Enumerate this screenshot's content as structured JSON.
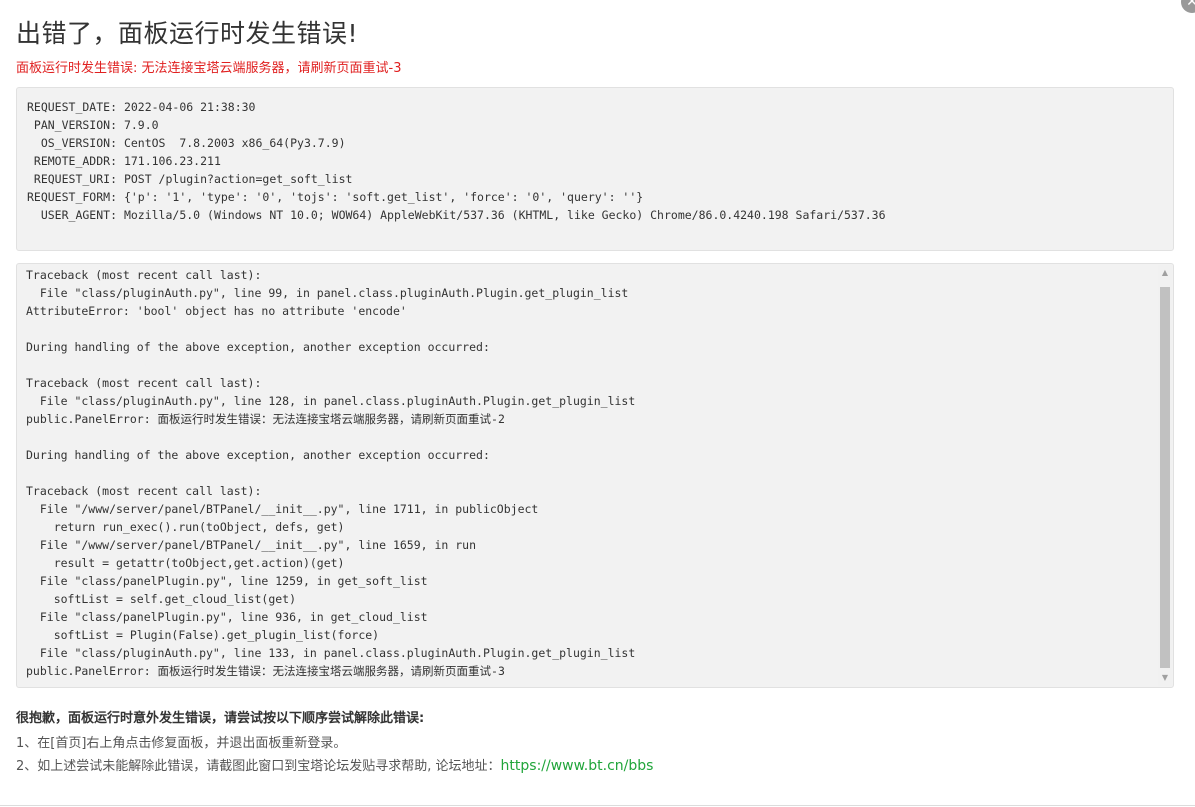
{
  "title": "出错了，面板运行时发生错误!",
  "subtitle": "面板运行时发生错误: 无法连接宝塔云端服务器，请刷新页面重试-3",
  "close_glyph": "✕",
  "info": [
    {
      "key": "REQUEST_DATE:",
      "value": "2022-04-06 21:38:30"
    },
    {
      "key": "PAN_VERSION:",
      "value": "7.9.0"
    },
    {
      "key": "OS_VERSION:",
      "value": "CentOS  7.8.2003 x86_64(Py3.7.9)"
    },
    {
      "key": "REMOTE_ADDR:",
      "value": "171.106.23.211"
    },
    {
      "key": "REQUEST_URI:",
      "value": "POST /plugin?action=get_soft_list"
    },
    {
      "key": "REQUEST_FORM:",
      "value": "{'p': '1', 'type': '0', 'tojs': 'soft.get_list', 'force': '0', 'query': ''}"
    },
    {
      "key": "USER_AGENT:",
      "value": "Mozilla/5.0 (Windows NT 10.0; WOW64) AppleWebKit/537.36 (KHTML, like Gecko) Chrome/86.0.4240.198 Safari/537.36"
    }
  ],
  "traceback": "Traceback (most recent call last):\n  File \"class/pluginAuth.py\", line 99, in panel.class.pluginAuth.Plugin.get_plugin_list\nAttributeError: 'bool' object has no attribute 'encode'\n\nDuring handling of the above exception, another exception occurred:\n\nTraceback (most recent call last):\n  File \"class/pluginAuth.py\", line 128, in panel.class.pluginAuth.Plugin.get_plugin_list\npublic.PanelError: 面板运行时发生错误：无法连接宝塔云端服务器，请刷新页面重试-2\n\nDuring handling of the above exception, another exception occurred:\n\nTraceback (most recent call last):\n  File \"/www/server/panel/BTPanel/__init__.py\", line 1711, in publicObject\n    return run_exec().run(toObject, defs, get)\n  File \"/www/server/panel/BTPanel/__init__.py\", line 1659, in run\n    result = getattr(toObject,get.action)(get)\n  File \"class/panelPlugin.py\", line 1259, in get_soft_list\n    softList = self.get_cloud_list(get)\n  File \"class/panelPlugin.py\", line 936, in get_cloud_list\n    softList = Plugin(False).get_plugin_list(force)\n  File \"class/pluginAuth.py\", line 133, in panel.class.pluginAuth.Plugin.get_plugin_list\npublic.PanelError: 面板运行时发生错误：无法连接宝塔云端服务器，请刷新页面重试-3",
  "scroll_up_glyph": "▲",
  "scroll_down_glyph": "▼",
  "help": {
    "title": "很抱歉，面板运行时意外发生错误，请尝试按以下顺序尝试解除此错误:",
    "step1": "1、在[首页]右上角点击修复面板，并退出面板重新登录。",
    "step2_text": "2、如上述尝试未能解除此错误，请截图此窗口到宝塔论坛发贴寻求帮助, 论坛地址：",
    "step2_link": "https://www.bt.cn/bbs"
  }
}
